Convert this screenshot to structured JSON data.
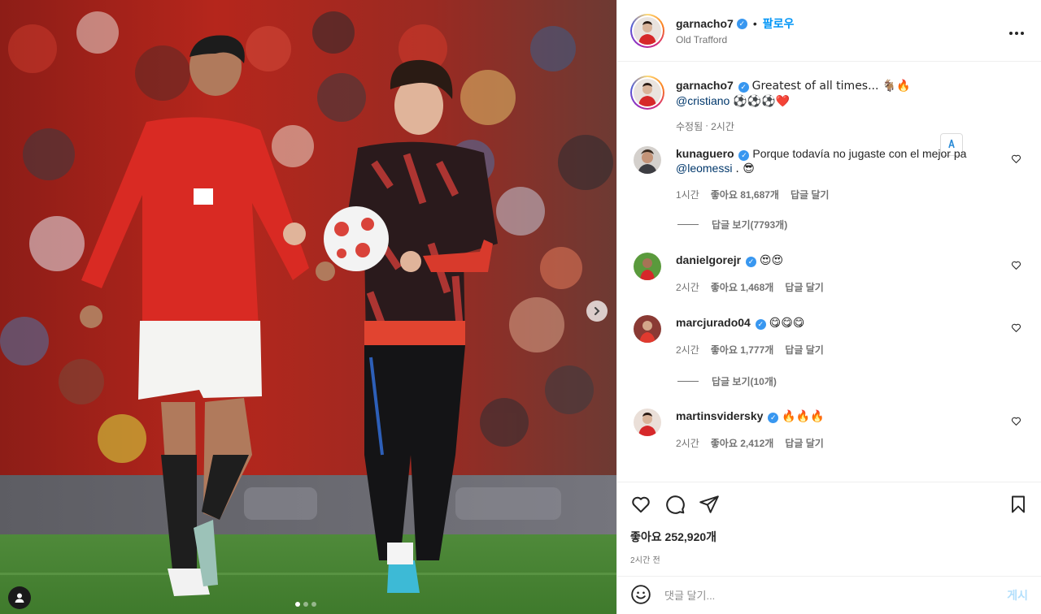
{
  "post": {
    "author": {
      "username": "garnacho7",
      "verified_badge": "✓",
      "follow_label": "팔로우",
      "separator": "•",
      "location": "Old Trafford"
    },
    "more_icon": "more-horizontal-icon",
    "carousel": {
      "dots": 3,
      "active_index": 0
    }
  },
  "caption": {
    "username": "garnacho7",
    "text": "Greatest of all times... 🐐🔥",
    "mention": "@cristiano",
    "emojis": "⚽⚽⚽❤️",
    "edited_label": "수정됨",
    "separator": "·",
    "time": "2시간"
  },
  "comments": [
    {
      "username": "kunaguero",
      "text": "Porque todavía no jugaste con el mejor pa",
      "mention": "@leomessi",
      "suffix": ". 😎",
      "time": "1시간",
      "likes": "좋아요 81,687개",
      "reply": "답글 달기",
      "view_replies": "답글 보기(7793개)"
    },
    {
      "username": "danielgorejr",
      "text": "😍😍",
      "time": "2시간",
      "likes": "좋아요 1,468개",
      "reply": "답글 달기"
    },
    {
      "username": "marcjurado04",
      "text": "😋😋😋",
      "time": "2시간",
      "likes": "좋아요 1,777개",
      "reply": "답글 달기",
      "view_replies": "답글 보기(10개)"
    },
    {
      "username": "martinsvidersky",
      "text": "🔥🔥🔥",
      "time": "2시간",
      "likes": "좋아요 2,412개",
      "reply": "답글 달기"
    }
  ],
  "actions": {
    "likes_count": "좋아요 252,920개",
    "posted_ago": "2시간 전"
  },
  "add_comment": {
    "placeholder": "댓글 달기...",
    "post_label": "게시"
  },
  "colors": {
    "accent": "#0095f6",
    "verified": "#3897f0",
    "post_button_disabled": "#b2dffc",
    "mention": "#00376b"
  }
}
